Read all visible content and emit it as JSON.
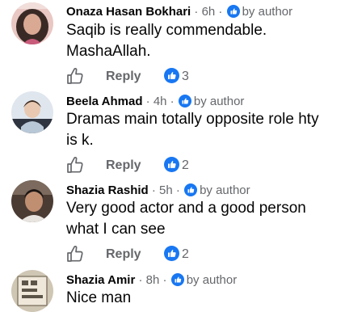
{
  "colors": {
    "accent": "#1877f2",
    "meta_text": "#65676b",
    "body_text": "#050505"
  },
  "icons": {
    "author": "author-badge-icon",
    "like": "thumbs-up-outline-icon",
    "reaction": "like-reaction-icon"
  },
  "comments": [
    {
      "name": "Onaza Hasan Bokhari",
      "sep": " · ",
      "time": "6h",
      "sep2": " · ",
      "author_label": "by author",
      "text": "Saqib is really commendable. MashaAllah.",
      "reply_label": "Reply",
      "reactions": "3"
    },
    {
      "name": "Beela Ahmad",
      "sep": " · ",
      "time": "4h",
      "sep2": " · ",
      "author_label": "by author",
      "text": "Dramas main totally opposite role hty is k.",
      "reply_label": "Reply",
      "reactions": "2"
    },
    {
      "name": "Shazia Rashid",
      "sep": " · ",
      "time": "5h",
      "sep2": " · ",
      "author_label": "by author",
      "text": "Very good actor and a good person what I can see",
      "reply_label": "Reply",
      "reactions": "2"
    },
    {
      "name": "Shazia Amir",
      "sep": " · ",
      "time": "8h",
      "sep2": " · ",
      "author_label": "by author",
      "text": "Nice man"
    }
  ]
}
